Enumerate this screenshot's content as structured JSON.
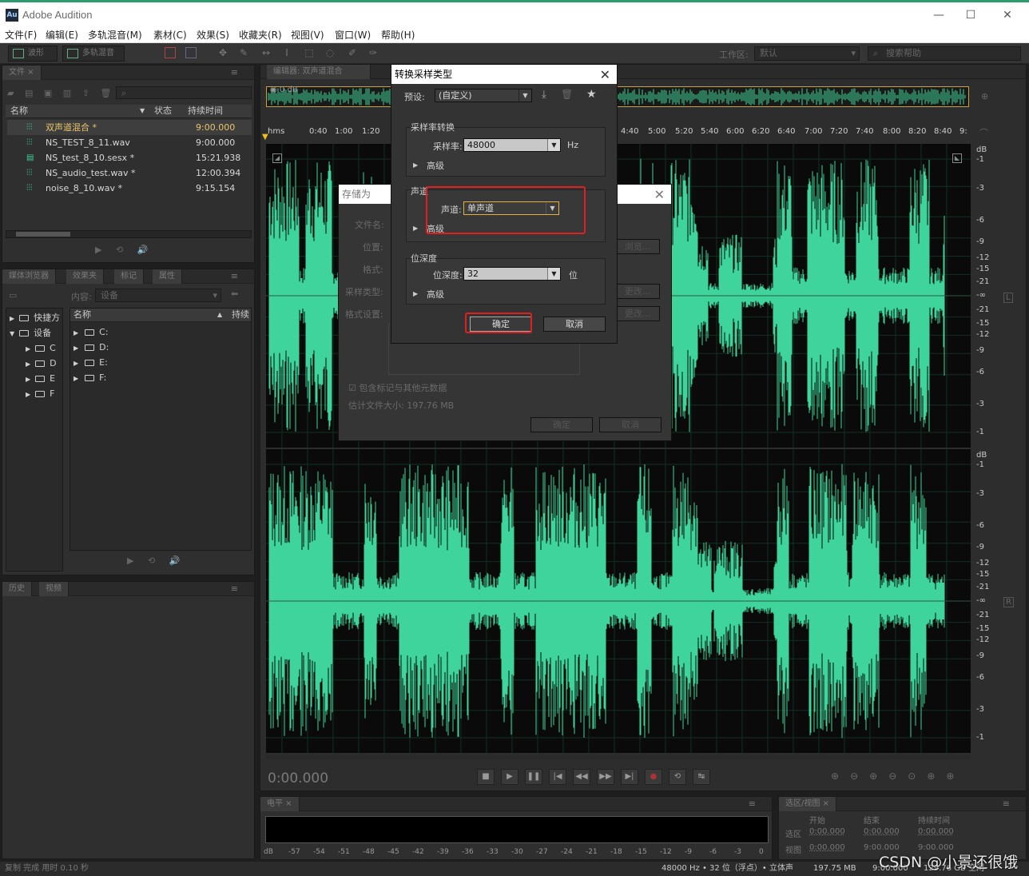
{
  "window": {
    "title": "Adobe Audition",
    "logo": "Au",
    "min": "—",
    "max": "☐",
    "close": "✕"
  },
  "menu": [
    "文件(F)",
    "编辑(E)",
    "多轨混音(M)",
    "素材(C)",
    "效果(S)",
    "收藏夹(R)",
    "视图(V)",
    "窗口(W)",
    "帮助(H)"
  ],
  "toolbar": {
    "waveform": "波形",
    "multitrack": "多轨混音",
    "workspace_label": "工作区:",
    "workspace_value": "默认",
    "search_placeholder": "搜索帮助"
  },
  "files_panel": {
    "tab": "文件",
    "columns": [
      "名称",
      "状态",
      "持续时间"
    ],
    "rows": [
      {
        "name": "双声道混合 *",
        "duration": "9:00.000",
        "icon": "waveform-icon"
      },
      {
        "name": "NS_TEST_8_11.wav",
        "duration": "9:00.000",
        "icon": "waveform-icon"
      },
      {
        "name": "NS_test_8_10.sesx *",
        "duration": "15:21.938",
        "icon": "session-icon"
      },
      {
        "name": "NS_audio_test.wav *",
        "duration": "12:00.394",
        "icon": "waveform-icon"
      },
      {
        "name": "noise_8_10.wav *",
        "duration": "9:15.154",
        "icon": "waveform-icon"
      }
    ]
  },
  "media_panel": {
    "tabs": [
      "媒体浏览器",
      "效果夹",
      "标记",
      "属性"
    ],
    "content_label": "内容:",
    "content_value": "设备",
    "tree": [
      "快捷方",
      "设备"
    ],
    "tree_drives": [
      "C",
      "D",
      "E",
      "F"
    ],
    "list_header": [
      "名称",
      "持续"
    ],
    "drives": [
      "C:",
      "D:",
      "E:",
      "F:"
    ]
  },
  "history_panel": {
    "tabs": [
      "历史",
      "视频"
    ]
  },
  "editor": {
    "tab": "编辑器: 双声道混合",
    "level": "0 dB",
    "time_labels": [
      "hms",
      "0:40",
      "1:00",
      "1:20",
      "4:40",
      "5:00",
      "5:20",
      "5:40",
      "6:00",
      "6:20",
      "6:40",
      "7:00",
      "7:20",
      "7:40",
      "8:00",
      "8:20",
      "8:40",
      "9:"
    ],
    "db_labels": [
      "dB",
      "-1",
      "-3",
      "-6",
      "-9",
      "-12",
      "-15",
      "-21",
      "-∞",
      "-21",
      "-15",
      "-12",
      "-9",
      "-6",
      "-3",
      "-1"
    ],
    "channel_left": "L",
    "channel_right": "R",
    "current_time": "0:00.000"
  },
  "save_dialog": {
    "title": "存储为",
    "labels": [
      "文件名:",
      "位置:",
      "格式:",
      "采样类型:",
      "格式设置:"
    ],
    "browse": "浏览...",
    "change": "更改...",
    "include_markers": "包含标记与其他元数据",
    "estimate": "估计文件大小: 197.76 MB",
    "ok": "确定",
    "cancel": "取消"
  },
  "convert_dialog": {
    "title": "转换采样类型",
    "preset_label": "预设:",
    "preset_value": "(自定义)",
    "samplerate_group": "采样率转换",
    "samplerate_label": "采样率:",
    "samplerate_value": "48000",
    "samplerate_unit": "Hz",
    "advanced": "高级",
    "channels_group": "声道",
    "channels_label": "声道:",
    "channels_value": "单声道",
    "bitdepth_group": "位深度",
    "bitdepth_label": "位深度:",
    "bitdepth_value": "32",
    "bitdepth_unit": "位",
    "ok": "确定",
    "cancel": "取消"
  },
  "level_panel": {
    "tab": "电平",
    "scale": [
      "dB",
      "-57",
      "-54",
      "-51",
      "-48",
      "-45",
      "-42",
      "-39",
      "-36",
      "-33",
      "-30",
      "-27",
      "-24",
      "-21",
      "-18",
      "-15",
      "-12",
      "-9",
      "-6",
      "-3",
      "0"
    ]
  },
  "selection_panel": {
    "tab": "选区/视图",
    "columns": [
      "开始",
      "结束",
      "持续时间"
    ],
    "rows": [
      {
        "label": "选区",
        "start": "0:00.000",
        "end": "0:00.000",
        "duration": "0:00.000"
      },
      {
        "label": "视图",
        "start": "0:00.000",
        "end": "9:00.000",
        "duration": "9:00.000"
      }
    ]
  },
  "status": {
    "left": "复制 完成 用时 0.10 秒",
    "format": "48000 Hz • 32 位（浮点）• 立体声",
    "size": "197.75 MB",
    "duration": "9:00.000",
    "free": "129.76 GB 空闲"
  },
  "watermark": "CSDN @小景还很饿",
  "colors": {
    "waveform": "#3fd49b",
    "accent": "#2c9b6e",
    "highlight": "#e02020",
    "playhead": "#f0c020"
  }
}
